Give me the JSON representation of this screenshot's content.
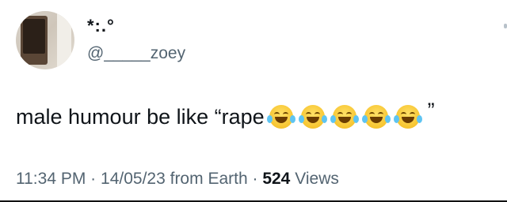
{
  "tweet": {
    "display_name": "*:.°",
    "handle": "@_____zoey",
    "text": "male humour be like “rape",
    "emoji_count": 5,
    "emoji_icon": "face-with-tears-of-joy-icon",
    "closing_quote": "”",
    "meta": {
      "time": "11:34 PM",
      "separator": "·",
      "date": "14/05/23",
      "source": "from Earth",
      "views_count": "524",
      "views_label": "Views"
    }
  }
}
